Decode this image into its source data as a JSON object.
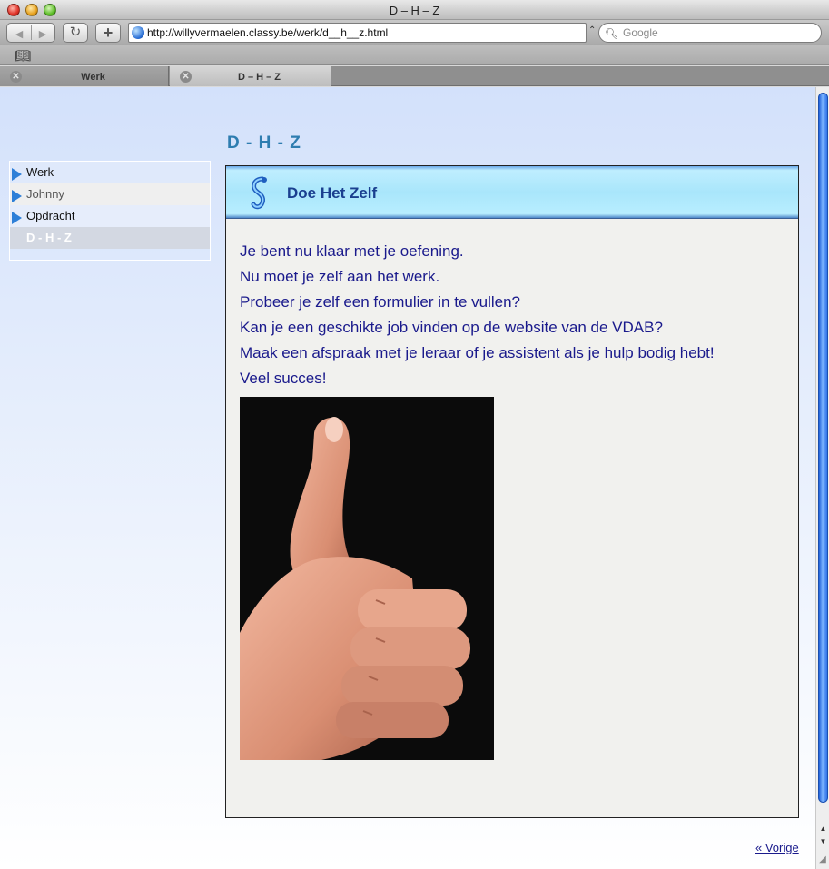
{
  "window": {
    "title": "D – H – Z"
  },
  "toolbar": {
    "back_label": "◀",
    "forward_label": "▶",
    "reload_label": "↻",
    "add_bookmark_label": "+",
    "url": "http://willyvermaelen.classy.be/werk/d__h__z.html",
    "search_placeholder": "Google"
  },
  "tabs": [
    {
      "label": "Werk",
      "active": false
    },
    {
      "label": "D – H – Z",
      "active": true
    }
  ],
  "page": {
    "title": "D - H - Z",
    "sidebar": {
      "items": [
        {
          "label": "Werk"
        },
        {
          "label": "Johnny"
        },
        {
          "label": "Opdracht"
        },
        {
          "label": "D - H - Z"
        }
      ]
    },
    "content": {
      "header_title": "Doe Het Zelf",
      "lines": [
        "Je bent nu klaar met je oefening.",
        "Nu moet je zelf aan het werk.",
        "Probeer je zelf een formulier in te vullen?",
        "Kan je een geschikte job vinden op de website van de VDAB?",
        "Maak een afspraak met je leraar of je assistent als je hulp bodig hebt!",
        "Veel succes!"
      ]
    },
    "prev_link": "« Vorige"
  },
  "colors": {
    "page_title": "#2e7db0",
    "content_text": "#1a1a8c",
    "header_band": "#a9e6fb"
  }
}
